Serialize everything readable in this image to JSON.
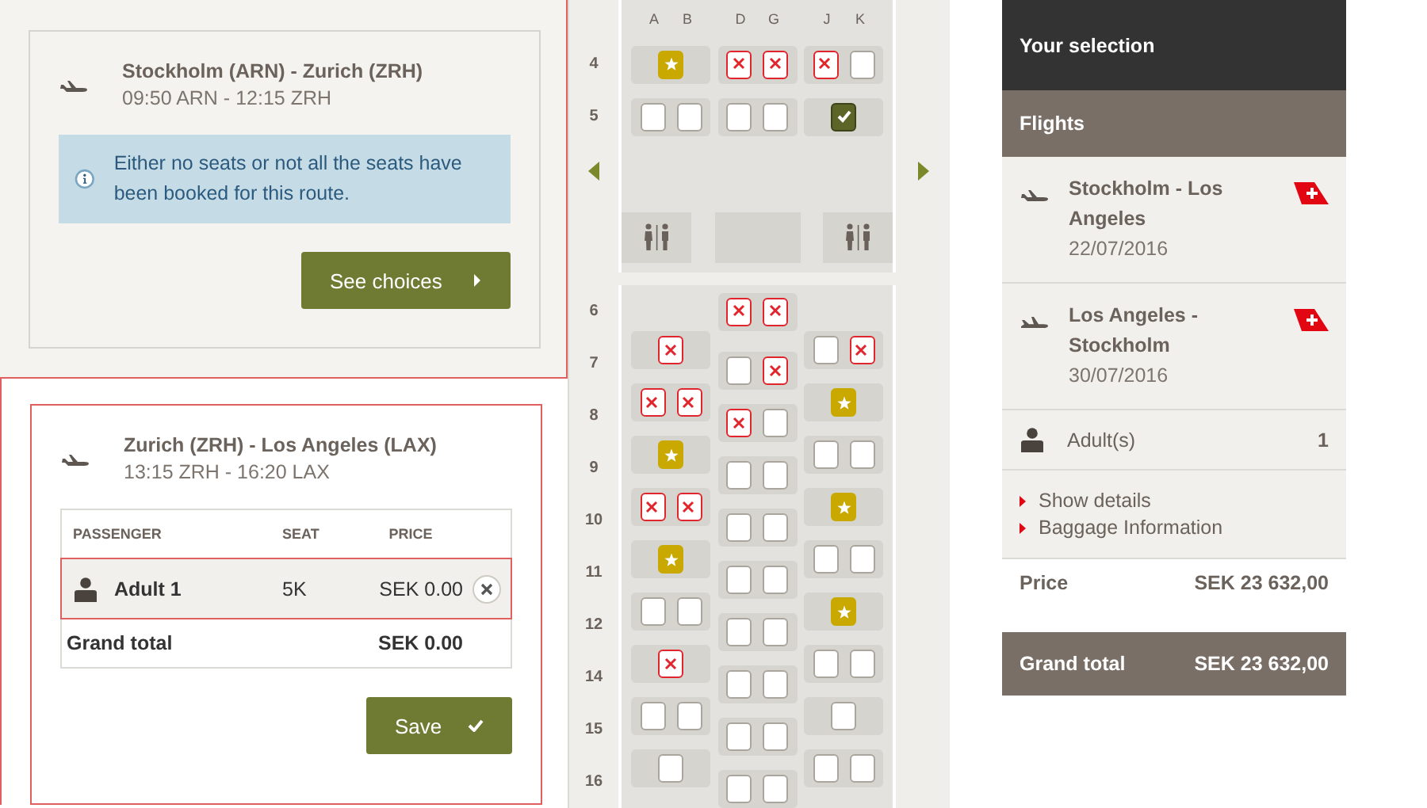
{
  "segments": [
    {
      "kind": "notice",
      "route": "Stockholm (ARN) - Zurich (ZRH)",
      "times": "09:50 ARN - 12:15 ZRH",
      "notice": "Either no seats or not all the seats have been booked for this route.",
      "button": "See choices"
    },
    {
      "kind": "table",
      "route": "Zurich (ZRH) - Los Angeles (LAX)",
      "times": "13:15 ZRH - 16:20 LAX",
      "columns": [
        "PASSENGER",
        "SEAT",
        "PRICE"
      ],
      "rows": [
        {
          "passenger": "Adult 1",
          "seat": "5K",
          "price": "SEK 0.00",
          "selected": true
        }
      ],
      "total": {
        "label": "Grand total",
        "value": "SEK 0.00"
      },
      "button": "Save"
    }
  ],
  "seat_map": {
    "columns": [
      "A",
      "B",
      "D",
      "G",
      "J",
      "K"
    ],
    "rows": [
      {
        "kind": "row",
        "number": "4",
        "middle_shifted": false,
        "groups": [
          {
            "kind": "left",
            "seats": [
              {
                "kind": "premium"
              }
            ]
          },
          {
            "kind": "middle",
            "seats": [
              {
                "kind": "taken"
              },
              {
                "kind": "taken"
              }
            ]
          },
          {
            "kind": "right",
            "seats": [
              {
                "kind": "taken"
              },
              {
                "kind": "free"
              }
            ]
          }
        ]
      },
      {
        "kind": "row",
        "number": "5",
        "middle_shifted": false,
        "groups": [
          {
            "kind": "left",
            "seats": [
              {
                "kind": "free"
              },
              {
                "kind": "free"
              }
            ]
          },
          {
            "kind": "middle",
            "seats": [
              {
                "kind": "free"
              },
              {
                "kind": "free"
              }
            ]
          },
          {
            "kind": "right",
            "seats": [
              {
                "kind": "selected"
              }
            ]
          }
        ]
      },
      {
        "kind": "exit"
      },
      {
        "kind": "lavatory"
      },
      {
        "kind": "row",
        "number": "6",
        "middle_shifted": false,
        "groups": [
          {
            "kind": "middle",
            "seats": [
              {
                "kind": "taken"
              },
              {
                "kind": "taken"
              }
            ]
          }
        ]
      },
      {
        "kind": "row",
        "number": "7",
        "middle_shifted": true,
        "groups": [
          {
            "kind": "left",
            "seats": [
              {
                "kind": "taken"
              }
            ]
          },
          {
            "kind": "middle",
            "seats": [
              {
                "kind": "free"
              },
              {
                "kind": "taken"
              }
            ]
          },
          {
            "kind": "right",
            "seats": [
              {
                "kind": "free"
              },
              {
                "kind": "taken"
              }
            ]
          }
        ]
      },
      {
        "kind": "row",
        "number": "8",
        "middle_shifted": true,
        "groups": [
          {
            "kind": "left",
            "seats": [
              {
                "kind": "taken"
              },
              {
                "kind": "taken"
              }
            ]
          },
          {
            "kind": "middle",
            "seats": [
              {
                "kind": "taken"
              },
              {
                "kind": "free"
              }
            ]
          },
          {
            "kind": "right",
            "seats": [
              {
                "kind": "premium"
              }
            ]
          }
        ]
      },
      {
        "kind": "row",
        "number": "9",
        "middle_shifted": true,
        "groups": [
          {
            "kind": "left",
            "seats": [
              {
                "kind": "premium"
              }
            ]
          },
          {
            "kind": "middle",
            "seats": [
              {
                "kind": "free"
              },
              {
                "kind": "free"
              }
            ]
          },
          {
            "kind": "right",
            "seats": [
              {
                "kind": "free"
              },
              {
                "kind": "free"
              }
            ]
          }
        ]
      },
      {
        "kind": "row",
        "number": "10",
        "middle_shifted": true,
        "groups": [
          {
            "kind": "left",
            "seats": [
              {
                "kind": "taken"
              },
              {
                "kind": "taken"
              }
            ]
          },
          {
            "kind": "middle",
            "seats": [
              {
                "kind": "free"
              },
              {
                "kind": "free"
              }
            ]
          },
          {
            "kind": "right",
            "seats": [
              {
                "kind": "premium"
              }
            ]
          }
        ]
      },
      {
        "kind": "row",
        "number": "11",
        "middle_shifted": true,
        "groups": [
          {
            "kind": "left",
            "seats": [
              {
                "kind": "premium"
              }
            ]
          },
          {
            "kind": "middle",
            "seats": [
              {
                "kind": "free"
              },
              {
                "kind": "free"
              }
            ]
          },
          {
            "kind": "right",
            "seats": [
              {
                "kind": "free"
              },
              {
                "kind": "free"
              }
            ]
          }
        ]
      },
      {
        "kind": "row",
        "number": "12",
        "middle_shifted": true,
        "groups": [
          {
            "kind": "left",
            "seats": [
              {
                "kind": "free"
              },
              {
                "kind": "free"
              }
            ]
          },
          {
            "kind": "middle",
            "seats": [
              {
                "kind": "free"
              },
              {
                "kind": "free"
              }
            ]
          },
          {
            "kind": "right",
            "seats": [
              {
                "kind": "premium"
              }
            ]
          }
        ]
      },
      {
        "kind": "row",
        "number": "14",
        "middle_shifted": true,
        "groups": [
          {
            "kind": "left",
            "seats": [
              {
                "kind": "taken"
              }
            ]
          },
          {
            "kind": "middle",
            "seats": [
              {
                "kind": "free"
              },
              {
                "kind": "free"
              }
            ]
          },
          {
            "kind": "right",
            "seats": [
              {
                "kind": "free"
              },
              {
                "kind": "free"
              }
            ]
          }
        ]
      },
      {
        "kind": "row",
        "number": "15",
        "middle_shifted": true,
        "groups": [
          {
            "kind": "left",
            "seats": [
              {
                "kind": "free"
              },
              {
                "kind": "free"
              }
            ]
          },
          {
            "kind": "middle",
            "seats": [
              {
                "kind": "free"
              },
              {
                "kind": "free"
              }
            ]
          },
          {
            "kind": "right",
            "seats": [
              {
                "kind": "free"
              }
            ]
          }
        ]
      },
      {
        "kind": "row",
        "number": "16",
        "middle_shifted": true,
        "groups": [
          {
            "kind": "left",
            "seats": [
              {
                "kind": "free"
              }
            ]
          },
          {
            "kind": "middle",
            "seats": [
              {
                "kind": "free"
              },
              {
                "kind": "free"
              }
            ]
          },
          {
            "kind": "right",
            "seats": [
              {
                "kind": "free"
              },
              {
                "kind": "free"
              }
            ]
          }
        ]
      }
    ]
  },
  "summary": {
    "title": "Your selection",
    "section": "Flights",
    "flights": [
      {
        "kind": "outbound",
        "route": "Stockholm - Los Angeles",
        "date": "22/07/2016"
      },
      {
        "kind": "return",
        "route": "Los Angeles - Stockholm",
        "date": "30/07/2016"
      }
    ],
    "passengers": {
      "label": "Adult(s)",
      "count": "1"
    },
    "links": [
      "Show details",
      "Baggage Information"
    ],
    "price": {
      "label": "Price",
      "value": "SEK 23 632,00"
    },
    "total": {
      "label": "Grand total",
      "value": "SEK 23 632,00"
    }
  }
}
